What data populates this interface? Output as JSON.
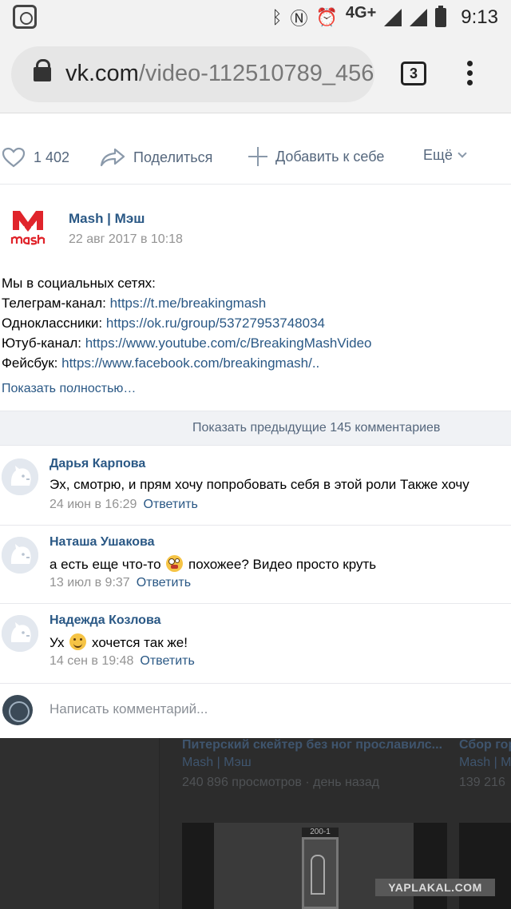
{
  "status_bar": {
    "network": "4G+",
    "time": "9:13"
  },
  "browser": {
    "url_domain": "vk.com",
    "url_path": "/video-112510789_456",
    "tab_count": "3"
  },
  "actions": {
    "likes": "1 402",
    "share_label": "Поделиться",
    "add_label": "Добавить к себе",
    "more_label": "Ещё"
  },
  "post": {
    "author": "Mash | Мэш",
    "date": "22 авг 2017 в 10:18",
    "intro": "Мы в социальных сетях:",
    "lines": [
      {
        "label": "Телеграм-канал: ",
        "link": "https://t.me/breakingmash"
      },
      {
        "label": "Одноклассники: ",
        "link": "https://ok.ru/group/53727953748034"
      },
      {
        "label": "Ютуб-канал: ",
        "link": "https://www.youtube.com/c/BreakingMashVideo"
      },
      {
        "label": "Фейсбук: ",
        "link": "https://www.facebook.com/breakingmash/.."
      }
    ],
    "show_full": "Показать полностью…"
  },
  "prev_comments": "Показать предыдущие 145 комментариев",
  "comments": [
    {
      "name": "Дарья Карпова",
      "text_before": "Эх, смотрю, и прям хочу попробовать себя в этой роли Также хочу",
      "text_after": "",
      "date": "24 июн в 16:29",
      "reply": "Ответить"
    },
    {
      "name": "Наташа Ушакова",
      "text_before": "а есть еще что-то",
      "text_after": "похожее? Видео просто круть",
      "date": "13 июл в 9:37",
      "reply": "Ответить"
    },
    {
      "name": "Надежда Козлова",
      "text_before": "Ух",
      "text_after": "хочется так же!",
      "date": "14 сен в 19:48",
      "reply": "Ответить"
    }
  ],
  "write_placeholder": "Написать комментарий...",
  "recommendations": [
    {
      "title": "Питерский скейтер без ног прославилс...",
      "author": "Mash | Мэш",
      "views": "240 896 просмотров",
      "age": "день назад"
    },
    {
      "title": "Сбор гор",
      "author": "Mash | М",
      "views": "139 216",
      "age": ""
    }
  ],
  "thumb_sign": "200-1",
  "watermark": "YAPLAKAL.COM",
  "colors": {
    "link": "#2a5885",
    "meta": "#939393",
    "action": "#55677d"
  }
}
